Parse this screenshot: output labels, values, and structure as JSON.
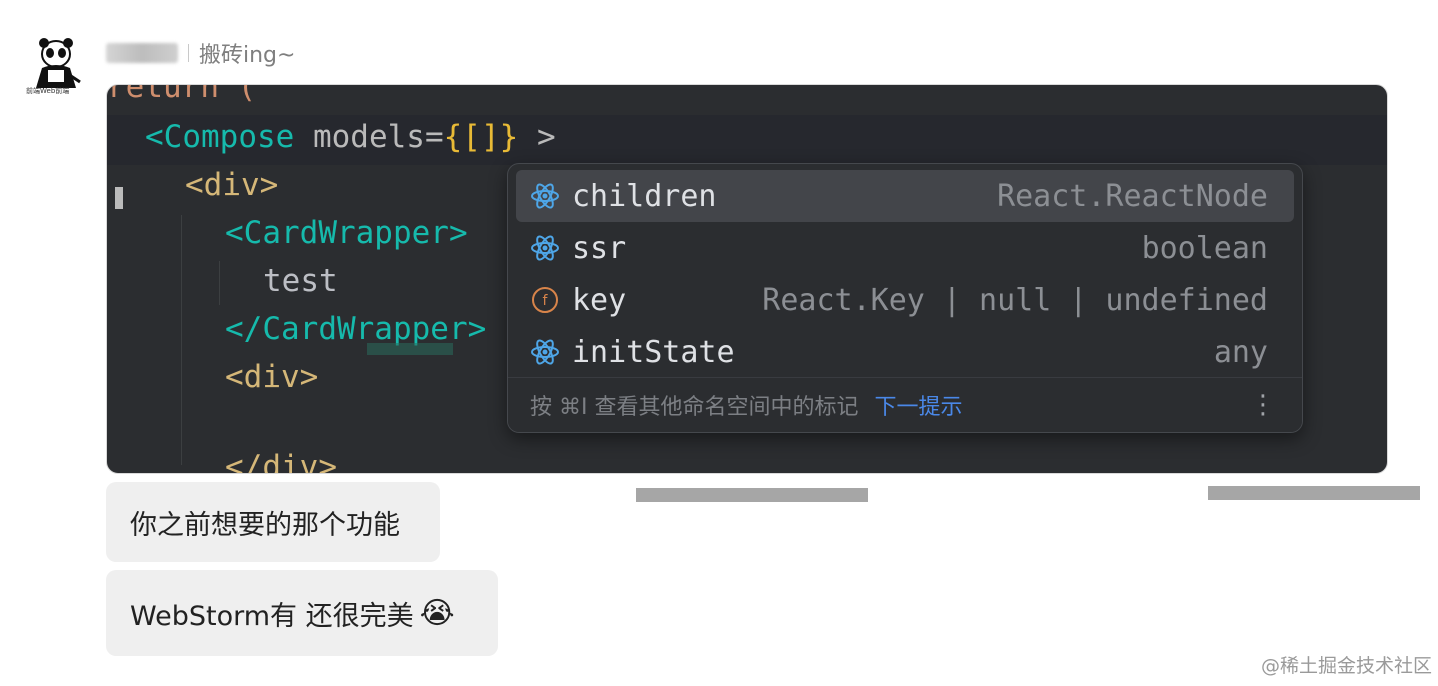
{
  "sender": {
    "status": "搬砖ing~",
    "avatar_caption": "前端Web前端"
  },
  "ide": {
    "code_lines": {
      "return": "return (",
      "compose_open": "<Compose",
      "compose_attr": " models=",
      "compose_value": "{[]}",
      "compose_close": " >",
      "div1": "<div>",
      "card_open": "<CardWrapper>",
      "text": "test",
      "card_close": "</CardWrapper>",
      "div2": "<div>",
      "div_close": "</div>"
    },
    "completion": {
      "items": [
        {
          "name": "children",
          "type": "React.ReactNode",
          "icon": "react-icon"
        },
        {
          "name": "ssr",
          "type": "boolean",
          "icon": "react-icon"
        },
        {
          "name": "key",
          "type": "React.Key | null | undefined",
          "icon": "field-icon"
        },
        {
          "name": "initState",
          "type": "any",
          "icon": "react-icon"
        }
      ],
      "footer_hint": "按 ⌘I 查看其他命名空间中的标记",
      "footer_link": "下一提示",
      "more": "⋮"
    }
  },
  "messages": [
    {
      "text": "你之前想要的那个功能"
    },
    {
      "text": "WebStorm有  还很完美",
      "emoji": "😭"
    }
  ],
  "watermark": "@稀土掘金技术社区",
  "colors": {
    "editor_bg": "#2b2d30",
    "react_icon": "#4ea6e8",
    "link": "#4a88e8",
    "bubble_bg": "#efefef"
  }
}
